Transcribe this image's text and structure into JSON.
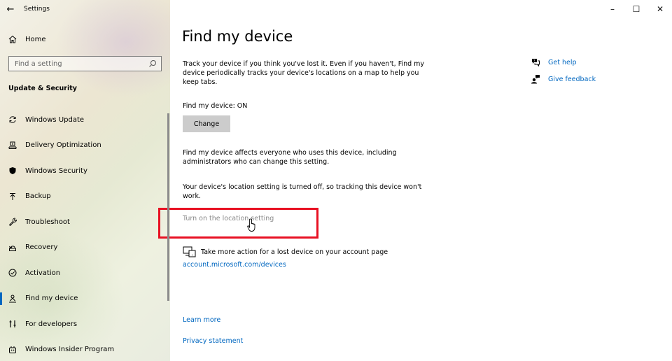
{
  "window": {
    "title": "Settings",
    "controls": {
      "minimize": "–",
      "maximize": "☐",
      "close": "✕"
    }
  },
  "sidebar": {
    "home_label": "Home",
    "search_placeholder": "Find a setting",
    "section_title": "Update & Security",
    "items": [
      {
        "label": "Windows Update",
        "icon": "sync-icon"
      },
      {
        "label": "Delivery Optimization",
        "icon": "delivery-icon"
      },
      {
        "label": "Windows Security",
        "icon": "shield-icon"
      },
      {
        "label": "Backup",
        "icon": "backup-arrow-icon"
      },
      {
        "label": "Troubleshoot",
        "icon": "wrench-icon"
      },
      {
        "label": "Recovery",
        "icon": "recovery-icon"
      },
      {
        "label": "Activation",
        "icon": "check-circle-icon"
      },
      {
        "label": "Find my device",
        "icon": "person-locate-icon",
        "active": true
      },
      {
        "label": "For developers",
        "icon": "developer-icon"
      },
      {
        "label": "Windows Insider Program",
        "icon": "insider-icon"
      }
    ]
  },
  "main": {
    "title": "Find my device",
    "description": "Track your device if you think you've lost it. Even if you haven't, Find my device periodically tracks your device's locations on a map to help you keep tabs.",
    "status": "Find my device: ON",
    "change_button": "Change",
    "affects_text": "Find my device affects everyone who uses this device, including administrators who can change this setting.",
    "location_off_text": "Your device's location setting is turned off, so tracking this device won't work.",
    "turn_on_link": "Turn on the location setting",
    "more_action_text": "Take more action for a lost device on your account page",
    "account_link": "account.microsoft.com/devices",
    "learn_more": "Learn more",
    "privacy_statement": "Privacy statement"
  },
  "help": {
    "get_help": "Get help",
    "give_feedback": "Give feedback"
  },
  "colors": {
    "accent": "#0067c0",
    "highlight_box": "#e81123",
    "disabled_text": "#8a8a8a"
  }
}
